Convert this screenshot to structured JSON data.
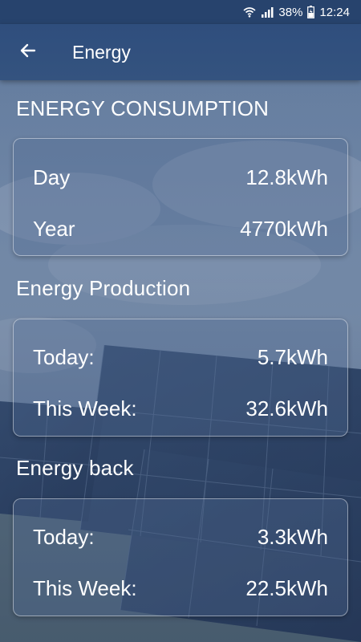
{
  "status_bar": {
    "battery_percent": "38%",
    "time": "12:24",
    "icons": [
      "wifi-icon",
      "signal-icon",
      "battery-icon"
    ]
  },
  "app_bar": {
    "title": "Energy",
    "back_icon": "arrow-left-icon"
  },
  "sections": [
    {
      "title": "ENERGY CONSUMPTION",
      "rows": [
        {
          "label": "Day",
          "value": "12.8kWh"
        },
        {
          "label": "Year",
          "value": "4770kWh"
        }
      ]
    },
    {
      "title": "Energy Production",
      "rows": [
        {
          "label": "Today:",
          "value": "5.7kWh"
        },
        {
          "label": "This Week:",
          "value": "32.6kWh"
        }
      ]
    },
    {
      "title": "Energy back",
      "rows": [
        {
          "label": "Today:",
          "value": "3.3kWh"
        },
        {
          "label": "This Week:",
          "value": "22.5kWh"
        }
      ]
    }
  ],
  "colors": {
    "status_bar": "#27436d",
    "app_bar": "#2f4e7d",
    "text": "#ffffff"
  }
}
